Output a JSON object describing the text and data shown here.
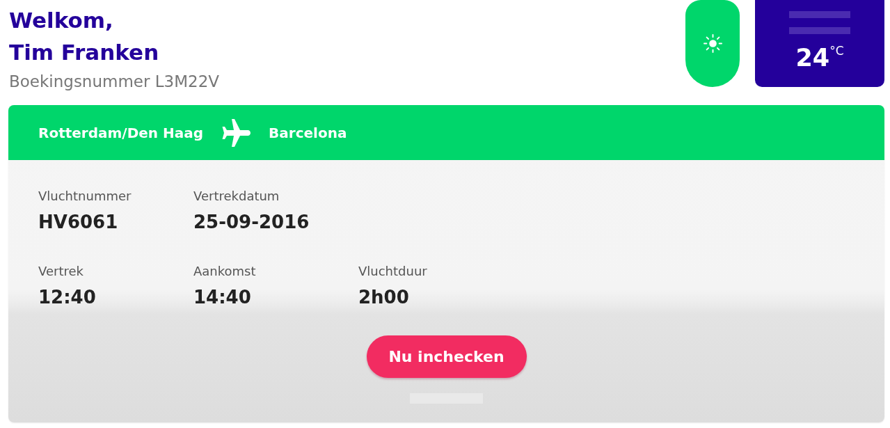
{
  "header": {
    "greeting": "Welkom,",
    "name": "Tim Franken",
    "booking": "Boekingsnummer L3M22V"
  },
  "weather": {
    "temperature": "24",
    "unit": "°C"
  },
  "flight": {
    "origin": "Rotterdam/Den Haag",
    "destination": "Barcelona",
    "rows": [
      [
        {
          "label": "Vluchtnummer",
          "value": "HV6061"
        },
        {
          "label": "Vertrekdatum",
          "value": "25-09-2016"
        }
      ],
      [
        {
          "label": "Vertrek",
          "value": "12:40"
        },
        {
          "label": "Aankomst",
          "value": "14:40"
        },
        {
          "label": "Vluchtduur",
          "value": "2h00"
        }
      ]
    ],
    "button": "Nu inchecken"
  }
}
